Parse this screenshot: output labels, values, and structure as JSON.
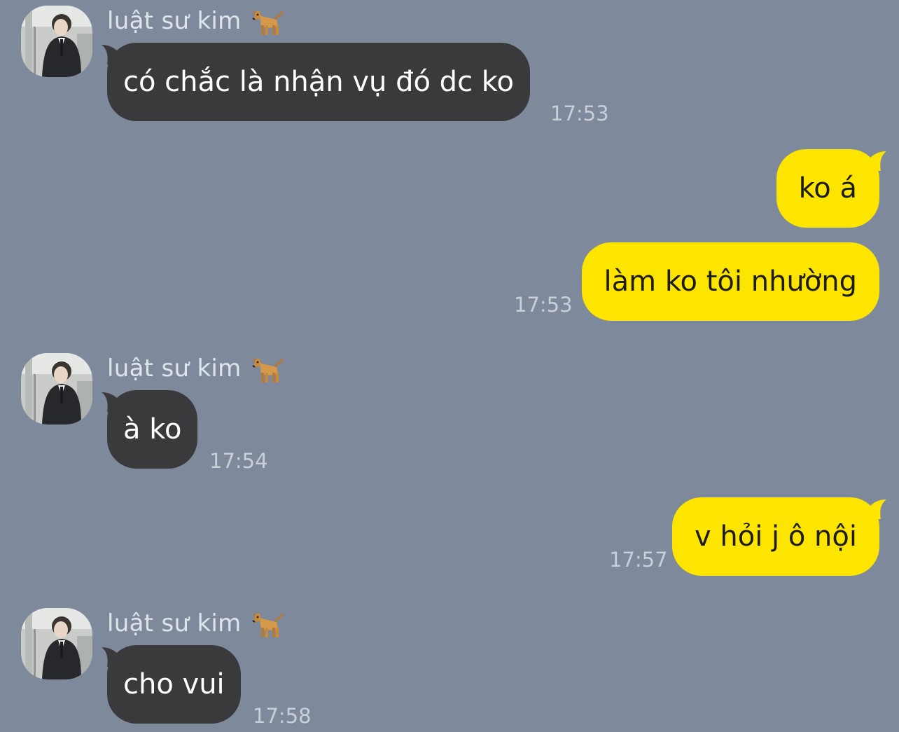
{
  "chat": {
    "messages": [
      {
        "direction": "incoming",
        "sender": "luật sư kim",
        "text": "có chắc là nhận vụ đó dc ko",
        "time": "17:53",
        "avatar": "avatar-icon",
        "sender_icon": "dog-icon"
      },
      {
        "direction": "outgoing",
        "text": "ko á",
        "time": ""
      },
      {
        "direction": "outgoing",
        "text": "làm ko tôi nhường",
        "time": "17:53"
      },
      {
        "direction": "incoming",
        "sender": "luật sư kim",
        "text": "à ko",
        "time": "17:54",
        "avatar": "avatar-icon",
        "sender_icon": "dog-icon"
      },
      {
        "direction": "outgoing",
        "text": "v hỏi j ô nội",
        "time": "17:57"
      },
      {
        "direction": "incoming",
        "sender": "luật sư kim",
        "text": "cho vui",
        "time": "17:58",
        "avatar": "avatar-icon",
        "sender_icon": "dog-icon"
      }
    ]
  },
  "colors": {
    "background": "#7f899c",
    "incoming_bubble": "#3a3a3c",
    "outgoing_bubble": "#fee500",
    "incoming_text": "#ffffff",
    "outgoing_text": "#1c1c1c",
    "timestamp": "#c9ced8",
    "sender_name": "#dfe3ec"
  }
}
